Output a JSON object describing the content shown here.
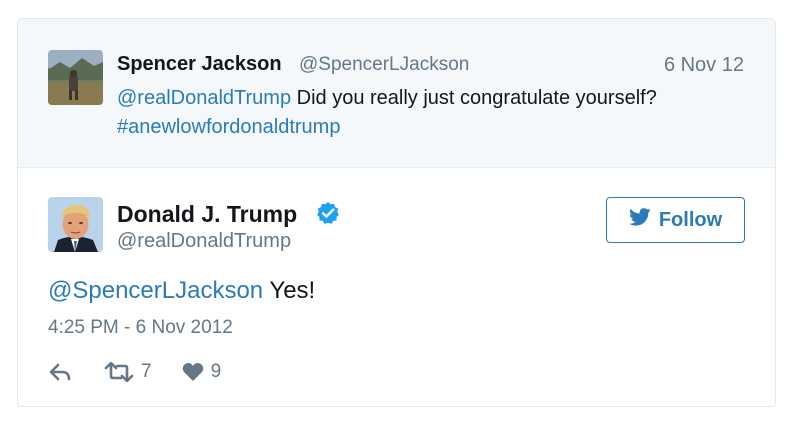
{
  "reply_context": {
    "name": "Spencer Jackson",
    "handle": "@SpencerLJackson",
    "date": "6 Nov 12",
    "mention": "@realDonaldTrump",
    "text": " Did you really just congratulate yourself?",
    "hashtag": "#anewlowfordonaldtrump"
  },
  "tweet": {
    "name": "Donald J. Trump",
    "handle": "@realDonaldTrump",
    "mention": "@SpencerLJackson",
    "text": " Yes!",
    "timestamp": "4:25 PM - 6 Nov 2012",
    "retweets": "7",
    "likes": "9"
  },
  "follow_button": {
    "label": "Follow"
  },
  "colors": {
    "link": "#2b7bb9",
    "muted": "#657786",
    "text": "#14171a",
    "verified": "#1da1f2",
    "context_bg": "#f5f8fa",
    "border": "#e1e8ed"
  },
  "icons": {
    "reply": "reply-icon",
    "retweet": "retweet-icon",
    "like": "heart-icon",
    "verified": "verified-badge-icon",
    "follow": "twitter-bird-icon"
  }
}
